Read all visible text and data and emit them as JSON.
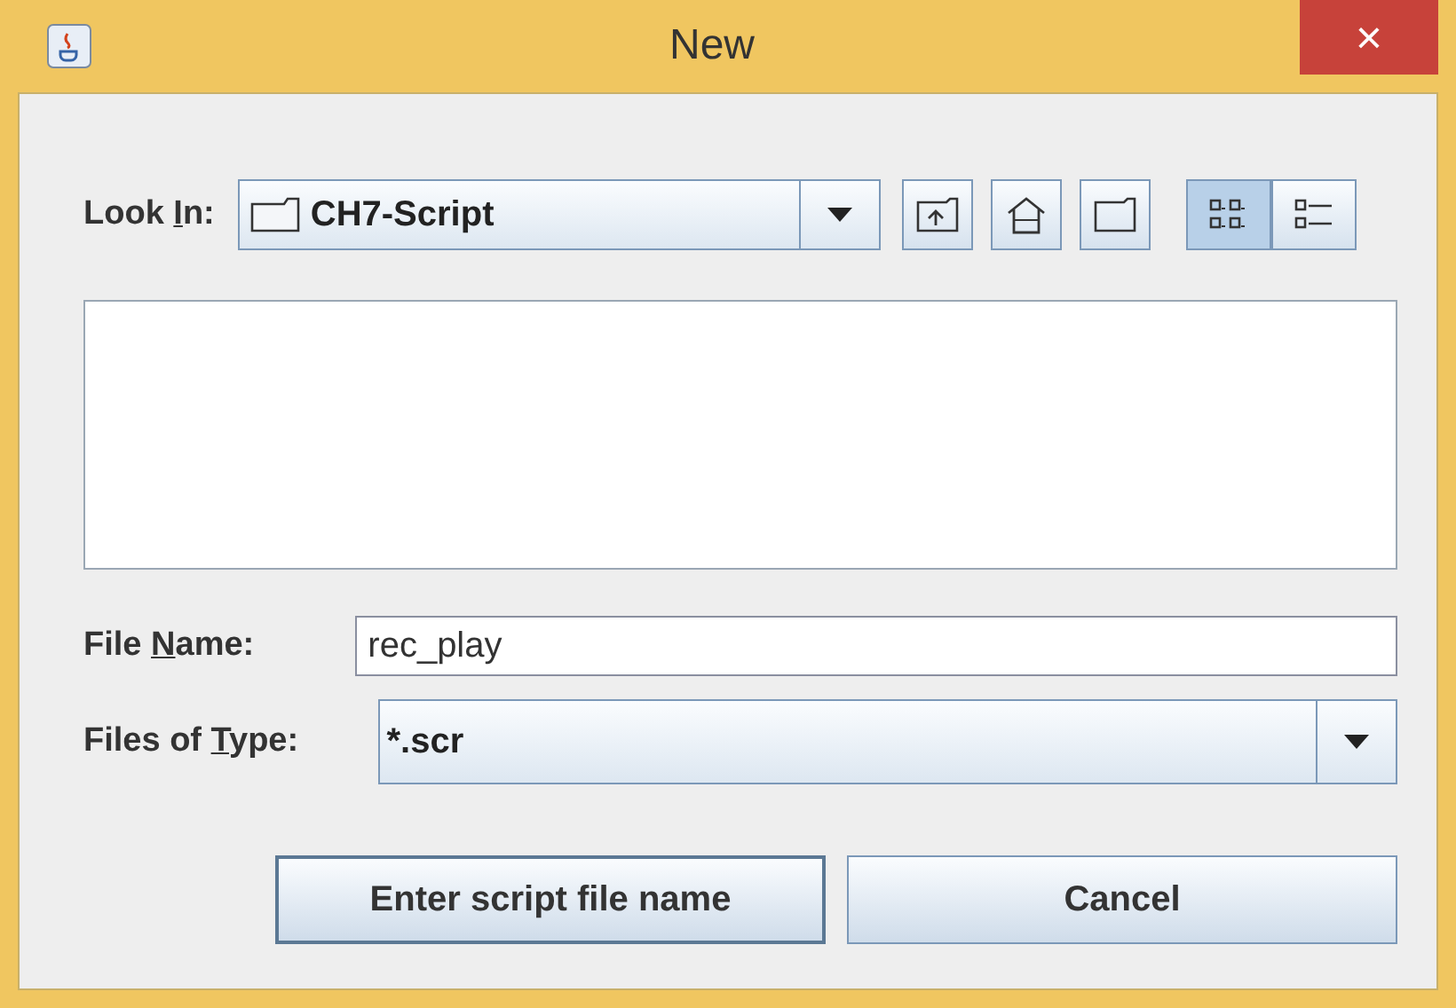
{
  "window": {
    "title": "New",
    "close": "×"
  },
  "look_in": {
    "label": {
      "before": "Look ",
      "key": "I",
      "after": "n:"
    },
    "value": "CH7-Script"
  },
  "nav_buttons": [
    {
      "kind": "up"
    },
    {
      "kind": "home"
    },
    {
      "kind": "new_folder"
    }
  ],
  "view_buttons": [
    {
      "kind": "list",
      "selected": true
    },
    {
      "kind": "details",
      "selected": false
    }
  ],
  "file_name": {
    "label": {
      "before": "File ",
      "key": "N",
      "after": "ame:"
    },
    "value": "rec_play"
  },
  "file_type": {
    "label": {
      "before": "Files of ",
      "key": "T",
      "after": "ype:"
    },
    "value": "*.scr"
  },
  "buttons": [
    {
      "label": "Enter script file name",
      "default": true
    },
    {
      "label": "Cancel",
      "default": false
    }
  ]
}
